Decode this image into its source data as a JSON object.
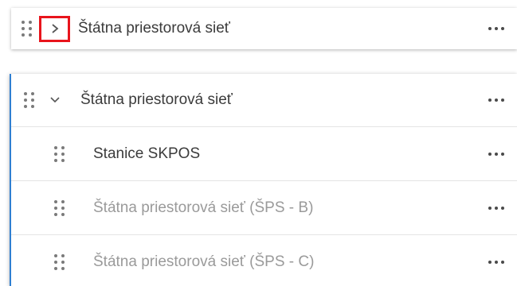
{
  "collapsed_layer": {
    "label": "Štátna priestorová sieť"
  },
  "expanded_group": {
    "label": "Štátna priestorová sieť",
    "accent_color": "#2f7fd1",
    "children": [
      {
        "label": "Stanice SKPOS",
        "visible": true
      },
      {
        "label": "Štátna priestorová sieť (ŠPS - B)",
        "visible": false
      },
      {
        "label": "Štátna priestorová sieť (ŠPS - C)",
        "visible": false
      }
    ]
  },
  "icons": {
    "drag": "drag-handle-icon",
    "expand": "chevron-right-icon",
    "collapse": "chevron-down-icon",
    "more": "more-options-icon"
  },
  "highlight_color": "#e8141c"
}
